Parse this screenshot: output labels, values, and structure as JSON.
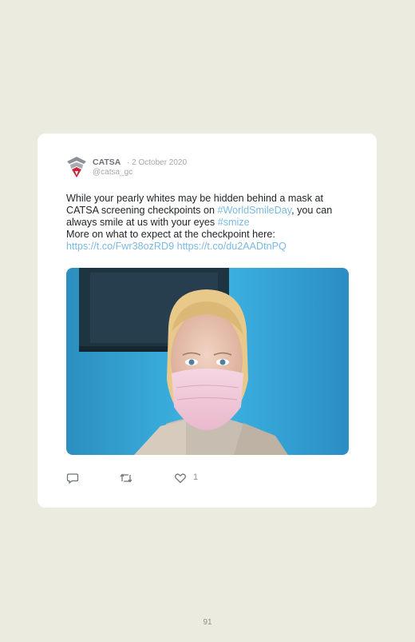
{
  "tweet": {
    "author_name": "CATSA",
    "date": "· 2 October 2020",
    "handle": "@catsa_gc",
    "text_1": "While your pearly whites may be hidden behind a mask at CATSA screening checkpoints on ",
    "hashtag_1": "#WorldSmileDay",
    "text_2": ", you can always smile at us with your eyes ",
    "hashtag_2": "#smize",
    "text_3": "More on what to expect at the checkpoint here:",
    "link_1": "https://t.co/Fwr38ozRD9",
    "link_2": "https://t.co/du2AADtnPQ",
    "like_count": "1"
  },
  "icons": [
    "reply-icon",
    "retweet-icon",
    "like-icon"
  ],
  "colors": {
    "background": "#ecebe0",
    "card": "#ffffff",
    "link": "#7bb9e0",
    "brand_red": "#c8283a"
  },
  "page": {
    "number": "91"
  }
}
